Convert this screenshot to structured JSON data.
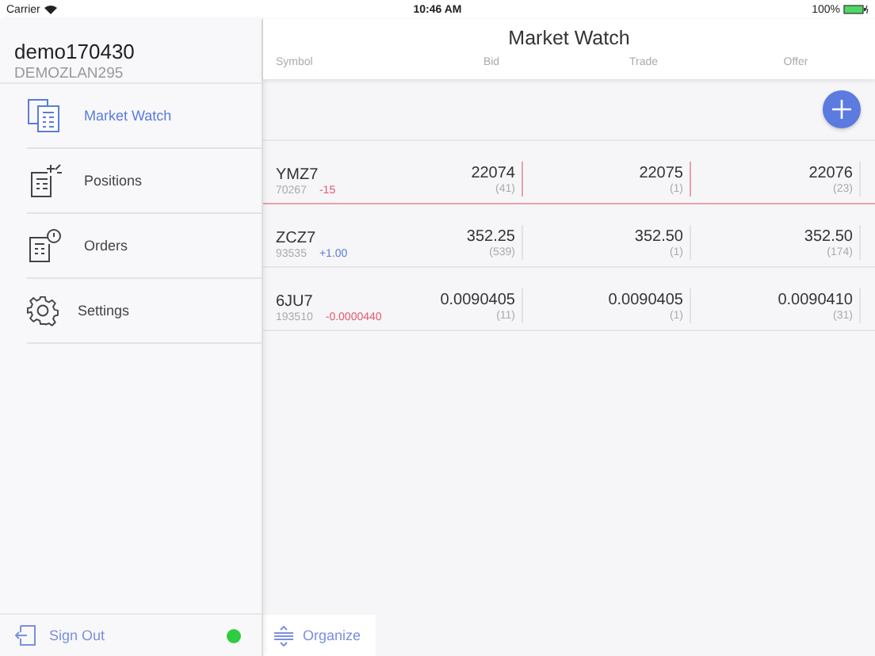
{
  "status_bar": {
    "carrier": "Carrier",
    "time": "10:46 AM",
    "battery": "100%"
  },
  "account": {
    "name": "demo170430",
    "id": "DEMOZLAN295"
  },
  "menu": [
    {
      "label": "Market Watch",
      "kind": "watch",
      "selected": true
    },
    {
      "label": "Positions",
      "kind": "positions",
      "selected": false
    },
    {
      "label": "Orders",
      "kind": "orders",
      "selected": false
    },
    {
      "label": "Settings",
      "kind": "settings",
      "selected": false
    }
  ],
  "sign_out": {
    "label": "Sign Out",
    "color": "#2ecc40"
  },
  "title": "Market Watch",
  "columns": [
    "Symbol",
    "Bid",
    "Trade",
    "Offer"
  ],
  "rows": [
    {
      "symbol": "YMZ7",
      "volume": "70267",
      "change": "-15",
      "color": "#e5566e",
      "bid": "22074",
      "bid_size": "(41)",
      "trade": "22075",
      "trade_size": "(1)",
      "offer": "22076",
      "offer_size": "(23)",
      "flash": true
    },
    {
      "symbol": "ZCZ7",
      "volume": "93535",
      "change": "+1.00",
      "color": "#5b7be0",
      "bid": "352.25",
      "bid_size": "(539)",
      "trade": "352.50",
      "trade_size": "(1)",
      "offer": "352.50",
      "offer_size": "(174)",
      "flash": false
    },
    {
      "symbol": "6JU7",
      "volume": "193510",
      "change": "-0.0000440",
      "color": "#e5566e",
      "bid": "0.0090405",
      "bid_size": "(11)",
      "trade": "0.0090405",
      "trade_size": "(1)",
      "offer": "0.0090410",
      "offer_size": "(31)",
      "flash": false
    }
  ],
  "organize": {
    "label": "Organize"
  }
}
